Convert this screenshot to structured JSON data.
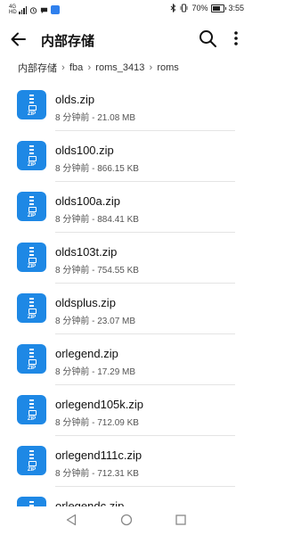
{
  "status_bar": {
    "network_label": "4G",
    "signal_label": "HD",
    "battery_text": "70%",
    "battery_level": 0.7,
    "time": "3:55",
    "icons": [
      "network-4g-icon",
      "signal-bars-icon",
      "alarm-icon",
      "message-icon",
      "app-notification-icon",
      "bluetooth-icon",
      "vibrate-icon",
      "battery-icon"
    ]
  },
  "app_bar": {
    "title": "内部存储",
    "icons": [
      "back-arrow-icon",
      "search-icon",
      "more-vert-icon"
    ]
  },
  "breadcrumb": [
    "内部存储",
    "fba",
    "roms_3413",
    "roms"
  ],
  "files": [
    {
      "name": "olds.zip",
      "meta": "8 分钟前 - 21.08 MB"
    },
    {
      "name": "olds100.zip",
      "meta": "8 分钟前 - 866.15 KB"
    },
    {
      "name": "olds100a.zip",
      "meta": "8 分钟前 - 884.41 KB"
    },
    {
      "name": "olds103t.zip",
      "meta": "8 分钟前 - 754.55 KB"
    },
    {
      "name": "oldsplus.zip",
      "meta": "8 分钟前 - 23.07 MB"
    },
    {
      "name": "orlegend.zip",
      "meta": "8 分钟前 - 17.29 MB"
    },
    {
      "name": "orlegend105k.zip",
      "meta": "8 分钟前 - 712.09 KB"
    },
    {
      "name": "orlegend111c.zip",
      "meta": "8 分钟前 - 712.31 KB"
    },
    {
      "name": "orlegendc.zip",
      "meta": ""
    }
  ],
  "file_icon_label": "ZIP",
  "colors": {
    "accent": "#1e88e5",
    "app_blue": "#2f80ed"
  },
  "nav_bar": {
    "icons": [
      "nav-back-icon",
      "nav-home-icon",
      "nav-recents-icon"
    ]
  }
}
